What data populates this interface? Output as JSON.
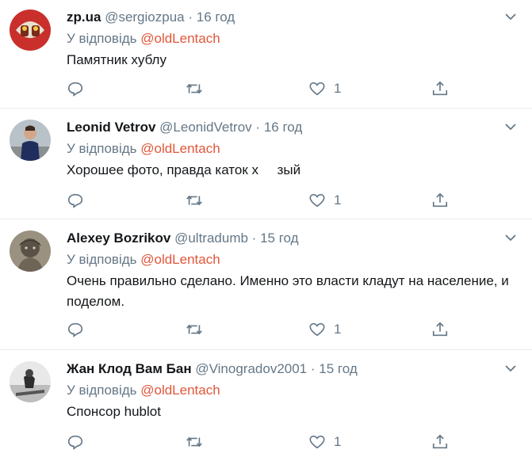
{
  "reply_prefix": "У відповідь",
  "tweets": [
    {
      "name": "zp.ua",
      "handle": "@sergiozpua",
      "time": "16 год",
      "reply_to": "@oldLentach",
      "text": "Памятник хублу",
      "likes": "1",
      "avatar_icon": "red-car-avatar"
    },
    {
      "name": "Leonid Vetrov",
      "handle": "@LeonidVetrov",
      "time": "16 год",
      "reply_to": "@oldLentach",
      "text": "Хорошее фото, правда каток х     зый",
      "likes": "1",
      "avatar_icon": "person-avatar"
    },
    {
      "name": "Alexey Bozrikov",
      "handle": "@ultradumb",
      "time": "15 год",
      "reply_to": "@oldLentach",
      "text": "Очень правильно сделано. Именно это власти кладут на население, и поделом.",
      "likes": "1",
      "avatar_icon": "statue-avatar"
    },
    {
      "name": "Жан Клод Вам Бан",
      "handle": "@Vinogradov2001",
      "time": "15 год",
      "reply_to": "@oldLentach",
      "text": "Спонсор hublot",
      "likes": "1",
      "avatar_icon": "bw-photo-avatar"
    }
  ],
  "colors": {
    "accent": "#e2563a",
    "muted": "#657786",
    "text": "#14171a",
    "divider": "#e6ecf0"
  }
}
